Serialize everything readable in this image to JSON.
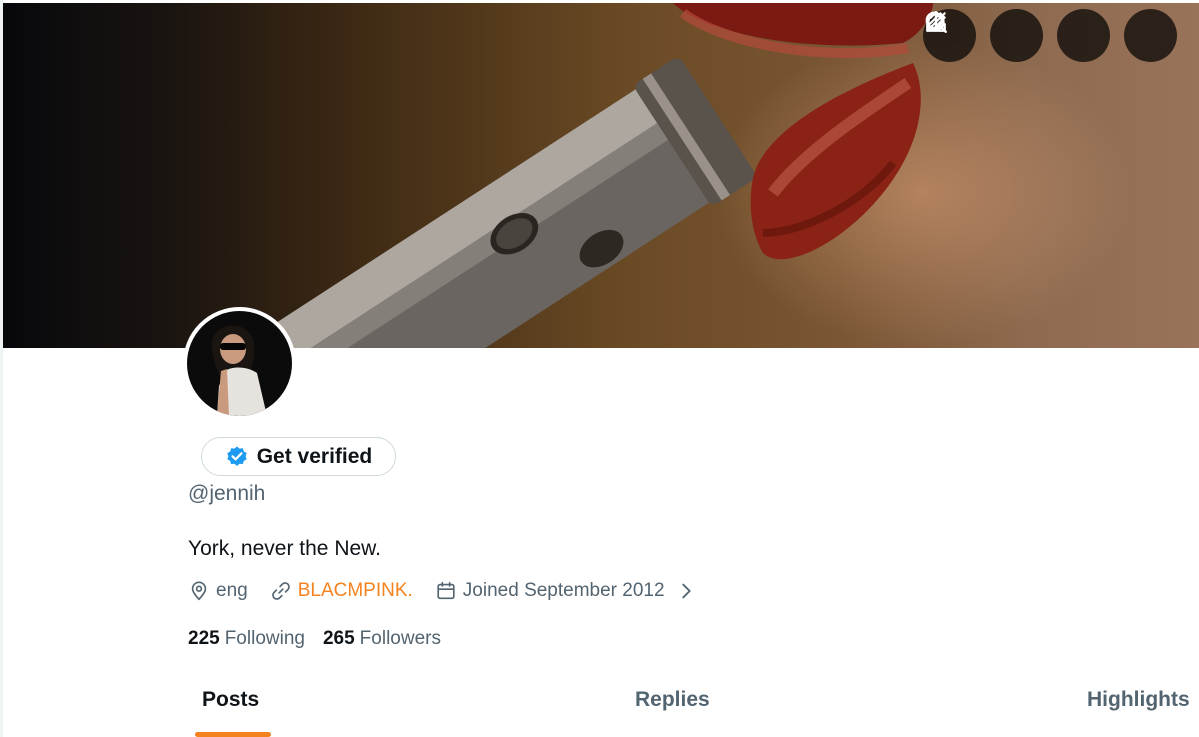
{
  "profile": {
    "handle": "@jennih",
    "bio": "York, never the New.",
    "location": "eng",
    "website": "BLACMPINK.",
    "joined": "Joined September 2012"
  },
  "verify": {
    "label": "Get verified"
  },
  "stats": {
    "following_count": "225",
    "following_label": "Following",
    "followers_count": "265",
    "followers_label": "Followers"
  },
  "tabs": [
    {
      "label": "Posts",
      "active": true
    },
    {
      "label": "Replies",
      "active": false
    },
    {
      "label": "Highlights",
      "active": false
    }
  ],
  "header_actions": [
    "grok-icon",
    "search-icon",
    "edit-icon",
    "share-icon"
  ],
  "colors": {
    "accent": "#f4821f",
    "verified": "#1d9bf0",
    "muted": "#536471",
    "text": "#0f1419"
  }
}
